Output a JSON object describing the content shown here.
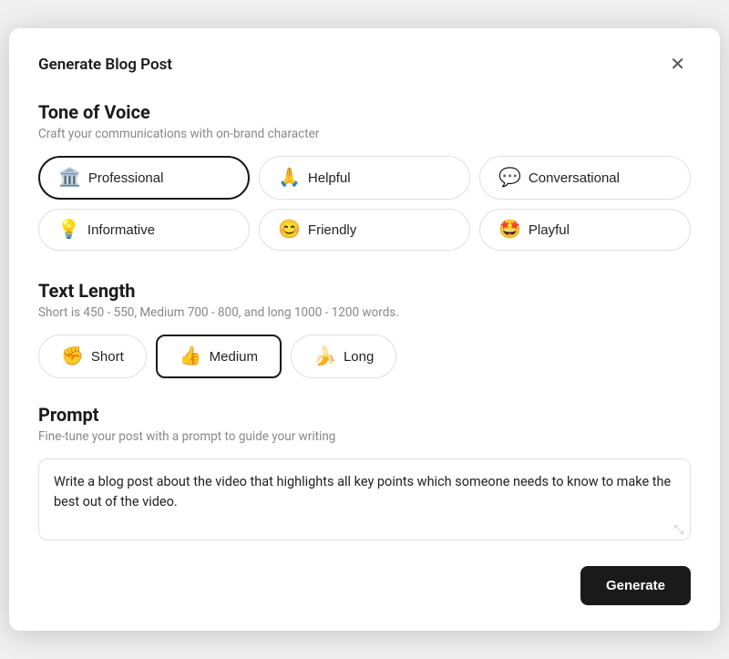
{
  "modal": {
    "title": "Generate Blog Post",
    "close_label": "✕"
  },
  "tone": {
    "section_title": "Tone of Voice",
    "section_subtitle": "Craft your communications with on-brand character",
    "options": [
      {
        "id": "professional",
        "label": "Professional",
        "emoji": "🏛️",
        "selected": true
      },
      {
        "id": "helpful",
        "label": "Helpful",
        "emoji": "🙏",
        "selected": false
      },
      {
        "id": "conversational",
        "label": "Conversational",
        "emoji": "💬",
        "selected": false
      },
      {
        "id": "informative",
        "label": "Informative",
        "emoji": "💡",
        "selected": false
      },
      {
        "id": "friendly",
        "label": "Friendly",
        "emoji": "😊",
        "selected": false
      },
      {
        "id": "playful",
        "label": "Playful",
        "emoji": "🤩",
        "selected": false
      }
    ]
  },
  "length": {
    "section_title": "Text Length",
    "section_subtitle": "Short is 450 - 550, Medium 700 - 800, and long 1000 - 1200 words.",
    "options": [
      {
        "id": "short",
        "label": "Short",
        "emoji": "✊",
        "selected": false
      },
      {
        "id": "medium",
        "label": "Medium",
        "emoji": "👍",
        "selected": true
      },
      {
        "id": "long",
        "label": "Long",
        "emoji": "🍌",
        "selected": false
      }
    ]
  },
  "prompt": {
    "section_title": "Prompt",
    "section_subtitle": "Fine-tune your post with a prompt to guide your writing",
    "value": "Write a blog post about the video that highlights all key points which someone needs to know to make the best out of the video."
  },
  "footer": {
    "generate_label": "Generate"
  }
}
